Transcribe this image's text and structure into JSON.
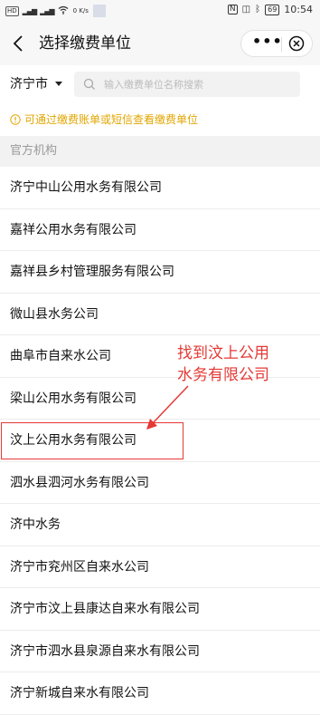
{
  "status_bar": {
    "carrier_icons": [
      "HD",
      "4G",
      "HD",
      "4G"
    ],
    "speed": "0\nK/s",
    "time": "10:54",
    "battery": "69"
  },
  "nav": {
    "title": "选择缴费单位",
    "more_label": "•••"
  },
  "filter": {
    "city": "济宁市",
    "search_placeholder": "输入缴费单位名称搜索"
  },
  "tip": "可通过缴费账单或短信查看缴费单位",
  "section_title": "官方机构",
  "items": [
    "济宁中山公用水务有限公司",
    "嘉祥公用水务有限公司",
    "嘉祥县乡村管理服务有限公司",
    "微山县水务公司",
    "曲阜市自来水公司",
    "梁山公用水务有限公司",
    "汶上公用水务有限公司",
    "泗水县泗河水务有限公司",
    "济中水务",
    "济宁市兖州区自来水公司",
    "济宁市汶上县康达自来水有限公司",
    "济宁市泗水县泉源自来水有限公司",
    "济宁新城自来水有限公司"
  ],
  "annotation": {
    "line1": "找到汶上公用",
    "line2": "水务有限公司"
  },
  "colors": {
    "accent_red": "#e53935",
    "tip_yellow": "#e0a600",
    "section_bg": "#f2f2f2"
  }
}
